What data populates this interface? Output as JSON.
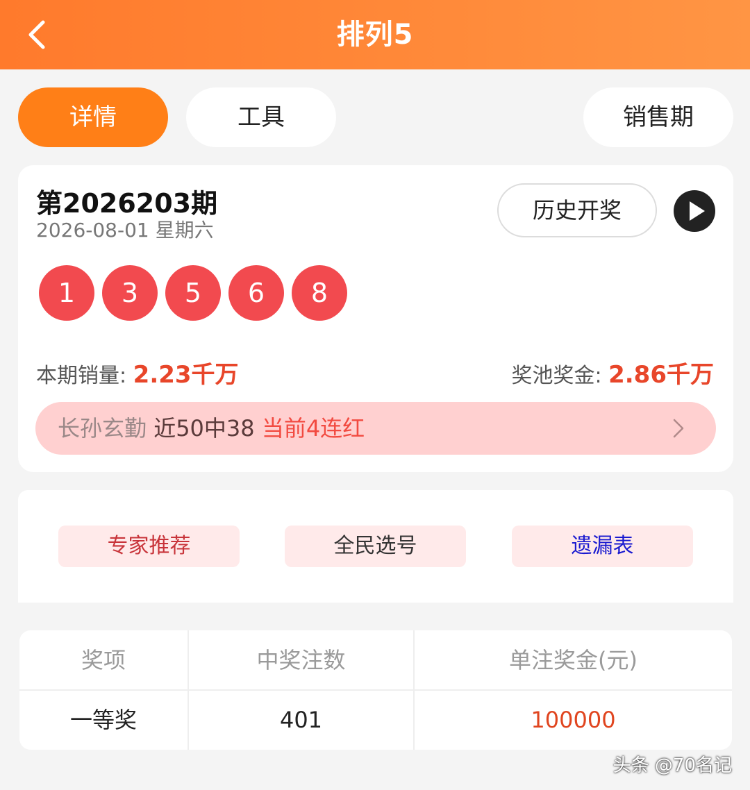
{
  "header": {
    "title": "排列5"
  },
  "tabs": [
    {
      "label": "详情",
      "active": true
    },
    {
      "label": "工具",
      "active": false
    },
    {
      "label": "销售期",
      "active": false
    }
  ],
  "draw": {
    "issue": "第2026203期",
    "date": "2026-08-01 星期六",
    "history_label": "历史开奖",
    "numbers": [
      "1",
      "3",
      "5",
      "6",
      "8"
    ],
    "sales_label": "本期销量:",
    "sales_value": "2.23千万",
    "pool_label": "奖池奖金:",
    "pool_value": "2.86千万"
  },
  "expert": {
    "name": "长孙玄勤",
    "record": "近50中38",
    "streak": "当前4连红"
  },
  "links": [
    {
      "label": "专家推荐",
      "color": "#c8343a"
    },
    {
      "label": "全民选号",
      "color": "#333333"
    },
    {
      "label": "遗漏表",
      "color": "#1a1ad0"
    }
  ],
  "prize_table": {
    "headers": [
      "奖项",
      "中奖注数",
      "单注奖金(元)"
    ],
    "rows": [
      {
        "level": "一等奖",
        "count": "401",
        "amount": "100000"
      }
    ]
  },
  "colors": {
    "accent": "#ff7f17",
    "ball": "#f24a4f",
    "highlight": "#e8462a"
  },
  "watermark": "头条 @70名记"
}
